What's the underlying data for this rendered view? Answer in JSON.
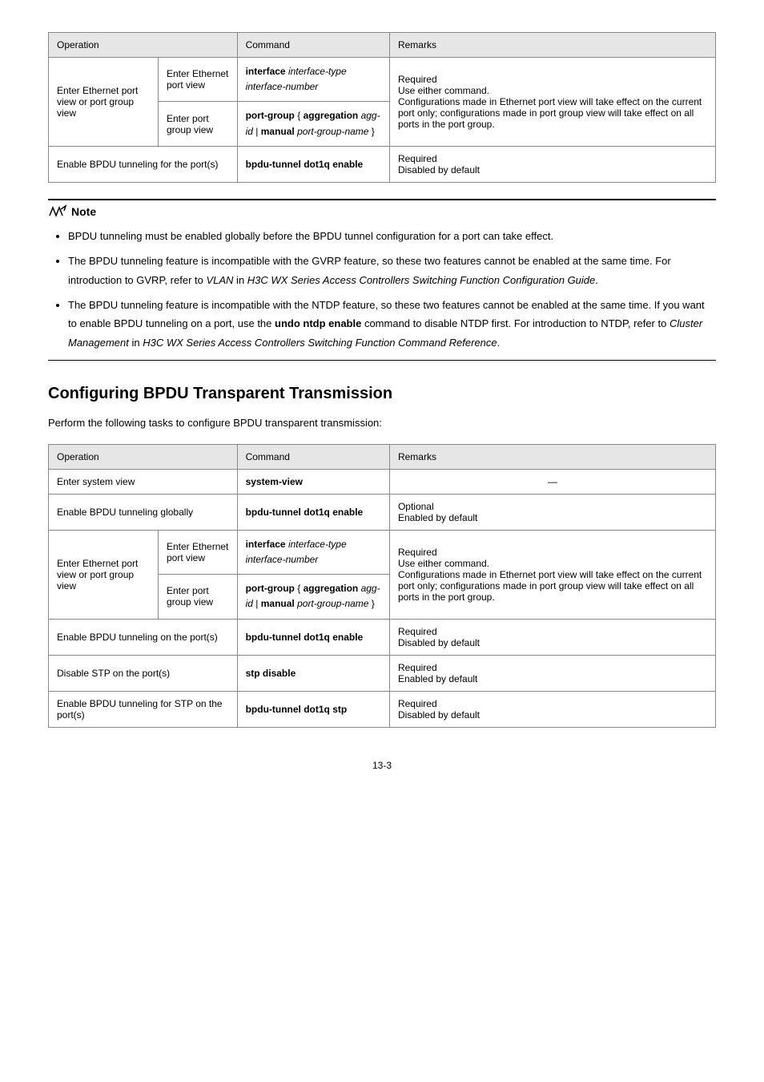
{
  "table1": {
    "headers": [
      "Operation",
      "",
      "Command",
      "Remarks"
    ],
    "row_enter": "Enter Ethernet port view or port group view",
    "eth_label": "Enter Ethernet port view",
    "eth_cmd_b": "interface",
    "eth_cmd_i": "interface-type interface-number",
    "eth_required": "Required",
    "eth_use_either": "Use either command.",
    "group_label": "Enter port group view",
    "group_cmd_b1": "port-group",
    "group_cmd_open": " {",
    "group_cmd_b2": " aggregation ",
    "group_cmd_i1": "agg-id",
    "group_cmd_pipe": " | ",
    "group_cmd_b3": " manual ",
    "group_cmd_i2": "port-group-name",
    "group_cmd_close": " }",
    "config_line": "Configurations made in Ethernet port view will take effect on the current port only; configurations made in port group view will take effect on all ports in the port group.",
    "enable_label": "Enable BPDU tunneling for the port(s)",
    "enable_cmd": "bpdu-tunnel dot1q enable",
    "enable_required": "Required",
    "enable_disabled": "Disabled by default"
  },
  "note": {
    "label": "Note",
    "items": [
      {
        "text_a": "BPDU tunneling must be enabled globally before the BPDU tunnel configuration for a port can take effect."
      },
      {
        "text_a": "The BPDU tunneling feature is incompatible with the GVRP feature, so these two features cannot be enabled at the same time. For introduction to GVRP, refer to ",
        "italic_a": "VLAN",
        "text_b": " in ",
        "italic_b": "H3C WX Series Access Controllers Switching Function Configuration Guide",
        "text_c": "."
      },
      {
        "text_a": "The BPDU tunneling feature is incompatible with the NTDP feature, so these two features cannot be enabled at the same time. If you want to enable BPDU tunneling on a port, use the ",
        "bold_a": "undo ntdp enable",
        "text_b": " command to disable NTDP first. For introduction to NTDP, refer to ",
        "italic_a": "Cluster Management",
        "text_c": " in ",
        "italic_b": "H3C WX Series Access Controllers Switching Function Command Reference",
        "text_d": "."
      }
    ]
  },
  "section": {
    "title": "Configuring BPDU Transparent Transmission",
    "sub": "Perform the following tasks to configure BPDU transparent transmission:"
  },
  "table2": {
    "headers": [
      "Operation",
      "",
      "Command",
      "Remarks"
    ],
    "sysview_label": "Enter system view",
    "sysview_cmd": "system-view",
    "sysview_dash": "—",
    "glob_label": "Enable BPDU tunneling globally",
    "glob_cmd": "bpdu-tunnel dot1q enable",
    "glob_opt": "Optional",
    "glob_enabled": "Enabled by default",
    "row_enter": "Enter Ethernet port view or port group view",
    "eth_label": "Enter Ethernet port view",
    "eth_cmd_b": "interface",
    "eth_cmd_i": "interface-type interface-number",
    "eth_required": "Required",
    "eth_use_either": "Use either command.",
    "group_label": "Enter port group view",
    "group_cmd_b1": "port-group",
    "group_cmd_open": " {",
    "group_cmd_b2": " aggregation ",
    "group_cmd_i1": "agg-id",
    "group_cmd_pipe": " | ",
    "group_cmd_b3": " manual ",
    "group_cmd_i2": "port-group-name",
    "group_cmd_close": " }",
    "config_line": "Configurations made in Ethernet port view will take effect on the current port only; configurations made in port group view will take effect on all ports in the port group.",
    "enable_on_label": "Enable BPDU tunneling on the port(s)",
    "enable_on_cmd": "bpdu-tunnel dot1q enable",
    "enable_on_req": "Required",
    "enable_on_dis": "Disabled by default",
    "disable_stp_label": "Disable STP on the port(s)",
    "disable_stp_cmd": "stp disable",
    "disable_stp_req": "Required",
    "disable_stp_en": "Enabled by default",
    "enable_stp_label": "Enable BPDU tunneling for STP on the port(s)",
    "enable_stp_cmd": "bpdu-tunnel dot1q stp",
    "enable_stp_req": "Required",
    "enable_stp_dis": "Disabled by default"
  },
  "page_num": "13-3"
}
